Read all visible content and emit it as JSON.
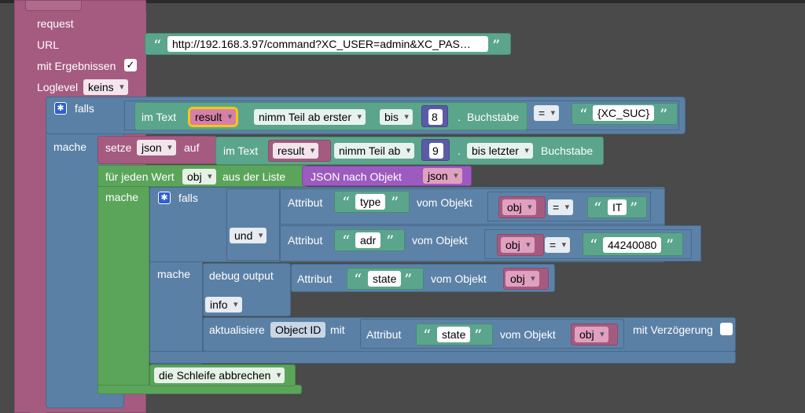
{
  "request_block": {
    "request_label": "request",
    "url_label": "URL",
    "url_value": "http://192.168.3.97/command?XC_USER=admin&XC_PAS…",
    "results_label": "mit Ergebnissen",
    "results_checked": "✓",
    "loglevel_label": "Loglevel",
    "loglevel_value": "keins"
  },
  "if1": {
    "falls_label": "falls",
    "mache_label": "mache",
    "condition": {
      "im_text_label": "im Text",
      "var": "result",
      "from_op": "nimm Teil ab erster",
      "to_op": "bis",
      "num": "8",
      "dot": ".",
      "suffix": "Buchstabe",
      "compare_op": "=",
      "text_value": "{XC_SUC}"
    }
  },
  "set_block": {
    "setze_label": "setze",
    "var": "json",
    "auf_label": "auf",
    "im_text_label": "im Text",
    "source_var": "result",
    "from_op": "nimm Teil ab",
    "num": "9",
    "dot": ".",
    "to_op": "bis letzter",
    "suffix": "Buchstabe"
  },
  "foreach": {
    "label": "für jeden Wert",
    "var": "obj",
    "list_label": "aus der Liste",
    "json_label": "JSON nach Objekt",
    "json_var": "json",
    "mache_label": "mache",
    "break_label": "die Schleife abbrechen"
  },
  "if2": {
    "falls_label": "falls",
    "mache_label": "mache",
    "und_label": "und",
    "cond1": {
      "attr_label": "Attribut",
      "attr_value": "type",
      "obj_label": "vom Objekt",
      "var": "obj",
      "op": "=",
      "value": "IT"
    },
    "cond2": {
      "attr_label": "Attribut",
      "attr_value": "adr",
      "obj_label": "vom Objekt",
      "var": "obj",
      "op": "=",
      "value": "44240080"
    }
  },
  "debug": {
    "label": "debug output",
    "attr_label": "Attribut",
    "attr_value": "state",
    "obj_label": "vom Objekt",
    "var": "obj",
    "level": "info"
  },
  "update": {
    "label": "aktualisiere",
    "id_label": "Object ID",
    "mit_label": "mit",
    "attr_label": "Attribut",
    "attr_value": "state",
    "obj_label": "vom Objekt",
    "var": "obj",
    "delay_label": "mit Verzögerung"
  },
  "colors": {
    "background": "#4a4a4a",
    "purple": "#a55b80",
    "blue": "#5b80a5",
    "green": "#5ba55b",
    "teal": "#5ba58c",
    "violet": "#9c5bbf"
  }
}
